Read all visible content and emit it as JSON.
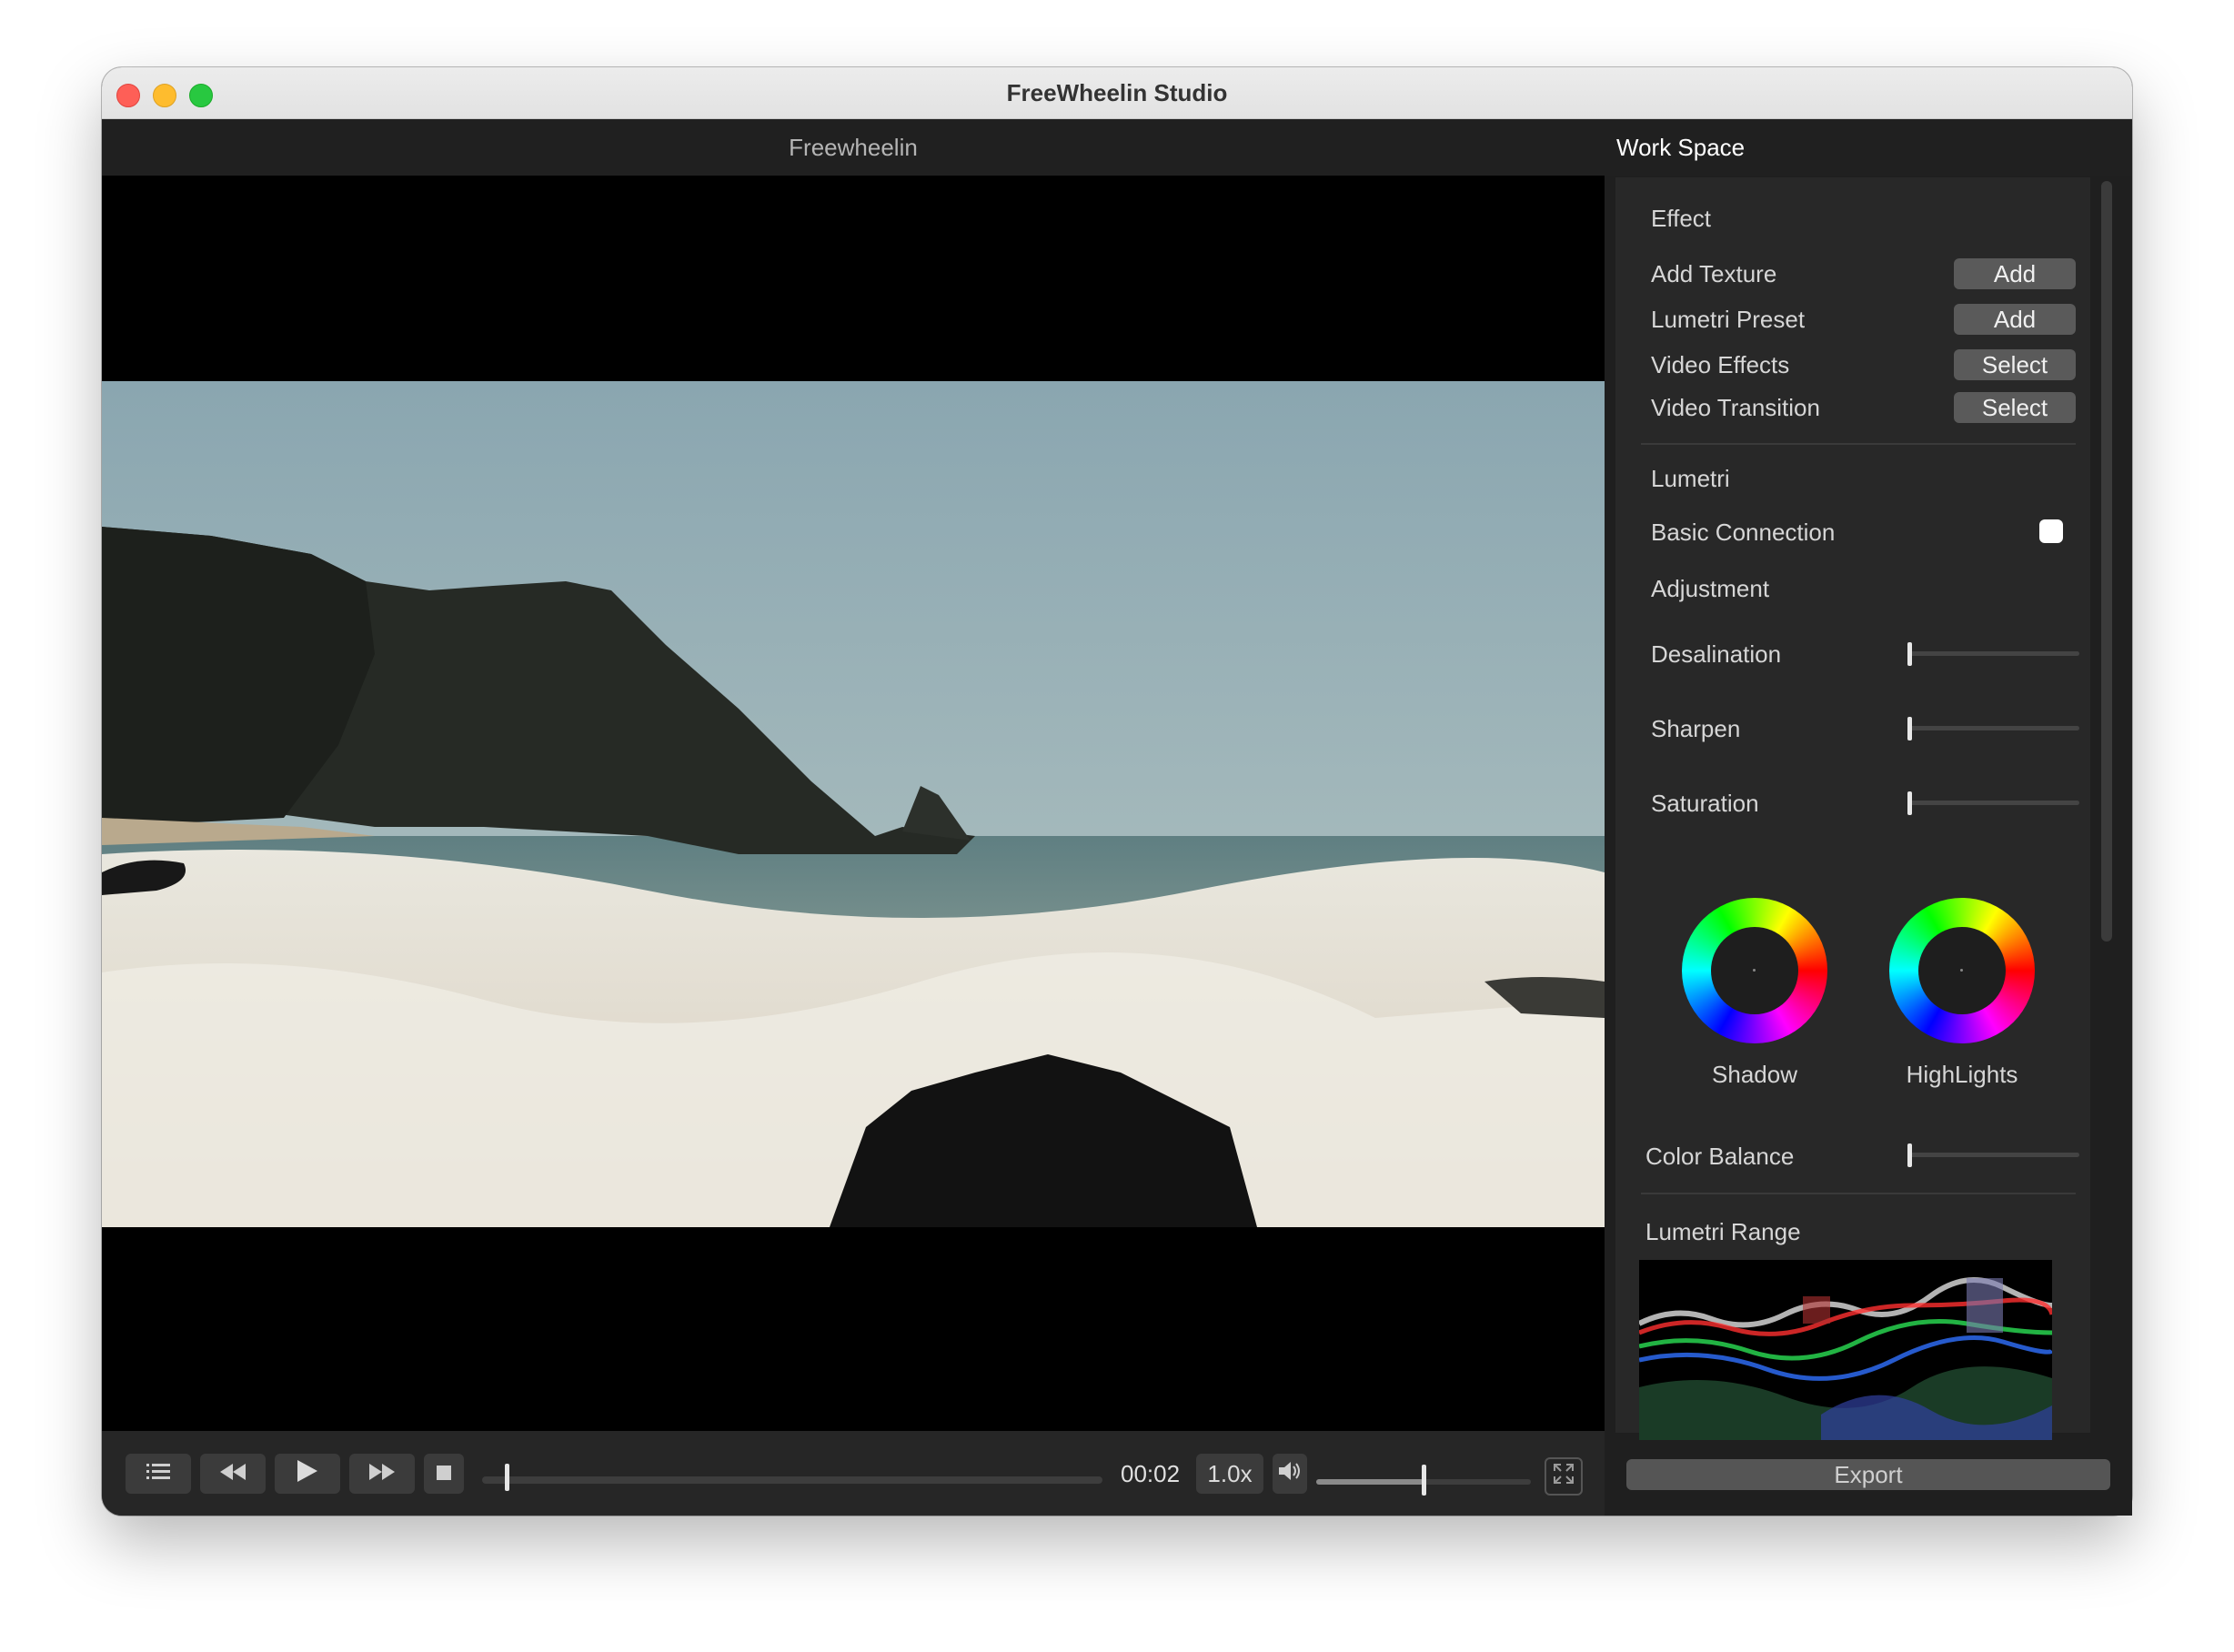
{
  "window": {
    "title": "FreeWheelin Studio"
  },
  "header": {
    "left_title": "Freewheelin",
    "right_title": "Work Space"
  },
  "player": {
    "time": "00:02",
    "speed": "1.0x",
    "progress_fraction": 0.03,
    "volume_fraction": 0.52,
    "icons": [
      "list-icon",
      "rewind-icon",
      "play-icon",
      "fast-forward-icon",
      "stop-icon",
      "volume-icon",
      "fullscreen-icon"
    ]
  },
  "panel": {
    "effect": {
      "title": "Effect",
      "rows": [
        {
          "label": "Add Texture",
          "button": "Add"
        },
        {
          "label": "Lumetri Preset",
          "button": "Add"
        },
        {
          "label": "Video Effects",
          "button": "Select"
        },
        {
          "label": "Video Transition",
          "button": "Select"
        }
      ]
    },
    "lumetri": {
      "title": "Lumetri",
      "basic_connection": {
        "label": "Basic Connection",
        "checked": false
      },
      "adjustment": {
        "title": "Adjustment",
        "sliders": [
          {
            "label": "Desalination",
            "value": 0
          },
          {
            "label": "Sharpen",
            "value": 0
          },
          {
            "label": "Saturation",
            "value": 0
          }
        ]
      },
      "wheels": [
        {
          "label": "Shadow"
        },
        {
          "label": "HighLights"
        }
      ],
      "color_balance": {
        "label": "Color Balance",
        "value": 0
      }
    },
    "lumetri_range": {
      "title": "Lumetri Range"
    },
    "export_label": "Export"
  }
}
